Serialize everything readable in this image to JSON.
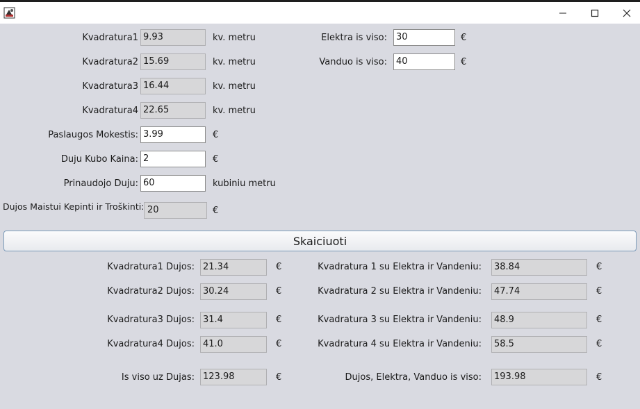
{
  "window": {
    "icon": "java-app-icon",
    "controls": {
      "minimize": "minimize-icon",
      "maximize": "maximize-icon",
      "close": "close-icon"
    }
  },
  "inputs": {
    "kv1": {
      "label": "Kvadratura1",
      "value": "9.93",
      "unit": "kv. metru"
    },
    "kv2": {
      "label": "Kvadratura2",
      "value": "15.69",
      "unit": "kv. metru"
    },
    "kv3": {
      "label": "Kvadratura3",
      "value": "16.44",
      "unit": "kv. metru"
    },
    "kv4": {
      "label": "Kvadratura4",
      "value": "22.65",
      "unit": "kv. metru"
    },
    "paslaugos": {
      "label": "Paslaugos Mokestis:",
      "value": "3.99",
      "unit": "€"
    },
    "kubo_kaina": {
      "label": "Duju Kubo Kaina:",
      "value": "2",
      "unit": "€"
    },
    "prinaudojo": {
      "label": "Prinaudojo Duju:",
      "value": "60",
      "unit": "kubiniu metru"
    },
    "maistui": {
      "label": "Dujos Maistui Kepinti ir Troškinti:",
      "value": "20",
      "unit": "€"
    },
    "elektra": {
      "label": "Elektra is viso:",
      "value": "30",
      "unit": "€"
    },
    "vanduo": {
      "label": "Vanduo is viso:",
      "value": "40",
      "unit": "€"
    }
  },
  "calculate_button": "Skaiciuoti",
  "results": {
    "gas": [
      {
        "label": "Kvadratura1  Dujos:",
        "value": "21.34",
        "unit": "€"
      },
      {
        "label": "Kvadratura2  Dujos:",
        "value": "30.24",
        "unit": "€"
      },
      {
        "label": "Kvadratura3  Dujos:",
        "value": "31.4",
        "unit": "€"
      },
      {
        "label": "Kvadratura4  Dujos:",
        "value": "41.0",
        "unit": "€"
      }
    ],
    "total": [
      {
        "label": "Kvadratura 1 su Elektra ir Vandeniu:",
        "value": "38.84",
        "unit": "€"
      },
      {
        "label": "Kvadratura 2 su Elektra ir Vandeniu:",
        "value": "47.74",
        "unit": "€"
      },
      {
        "label": "Kvadratura 3 su Elektra ir Vandeniu:",
        "value": "48.9",
        "unit": "€"
      },
      {
        "label": "Kvadratura 4 su Elektra ir Vandeniu:",
        "value": "58.5",
        "unit": "€"
      }
    ],
    "gas_sum": {
      "label": "Is viso uz Dujas:",
      "value": "123.98",
      "unit": "€"
    },
    "grand_total": {
      "label": "Dujos, Elektra, Vanduo is viso:",
      "value": "193.98",
      "unit": "€"
    }
  }
}
